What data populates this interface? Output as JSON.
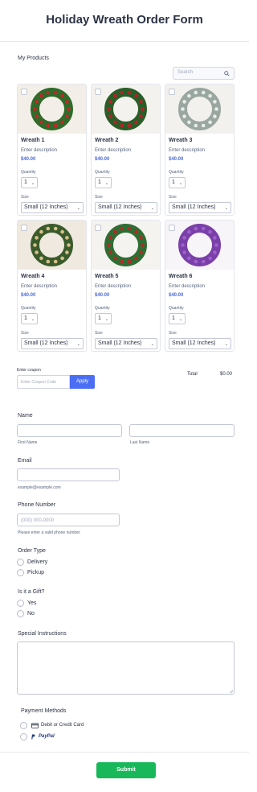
{
  "form": {
    "title": "Holiday Wreath Order Form"
  },
  "products": {
    "section_label": "My Products",
    "search_placeholder": "Search",
    "quantity_label": "Quantity",
    "size_label": "Size",
    "items": [
      {
        "name": "Wreath 1",
        "description": "Enter description",
        "price": "$40.00",
        "quantity": "1",
        "size": "Small (12 Inches)"
      },
      {
        "name": "Wreath 2",
        "description": "Enter description",
        "price": "$40.00",
        "quantity": "1",
        "size": "Small (12 Inches)"
      },
      {
        "name": "Wreath 3",
        "description": "Enter description",
        "price": "$40.00",
        "quantity": "1",
        "size": "Small (12 Inches)"
      },
      {
        "name": "Wreath 4",
        "description": "Enter description",
        "price": "$40.00",
        "quantity": "1",
        "size": "Small (12 Inches)"
      },
      {
        "name": "Wreath 5",
        "description": "Enter description",
        "price": "$40.00",
        "quantity": "1",
        "size": "Small (12 Inches)"
      },
      {
        "name": "Wreath 6",
        "description": "Enter description",
        "price": "$40.00",
        "quantity": "1",
        "size": "Small (12 Inches)"
      }
    ]
  },
  "coupon": {
    "label": "Enter coupon",
    "placeholder": "Enter Coupon Code",
    "apply_label": "Apply"
  },
  "total": {
    "label": "Total",
    "value": "$0.00"
  },
  "name_field": {
    "label": "Name",
    "first_sublabel": "First Name",
    "last_sublabel": "Last Name"
  },
  "email_field": {
    "label": "Email",
    "sublabel": "example@example.com"
  },
  "phone_field": {
    "label": "Phone Number",
    "placeholder": "(000) 000-0000",
    "sublabel": "Please enter a valid phone number."
  },
  "order_type": {
    "label": "Order Type",
    "options": [
      "Delivery",
      "Pickup"
    ]
  },
  "gift": {
    "label": "Is it a Gift?",
    "options": [
      "Yes",
      "No"
    ]
  },
  "instructions": {
    "label": "Special Instructions"
  },
  "payment": {
    "label": "Payment Methods",
    "card_label": "Debit or Credit Card",
    "paypal_label": "PayPal"
  },
  "submit_label": "Submit",
  "colors": {
    "accent": "#4c6ef5",
    "submit": "#18b85a",
    "price": "#4d6bd8"
  }
}
